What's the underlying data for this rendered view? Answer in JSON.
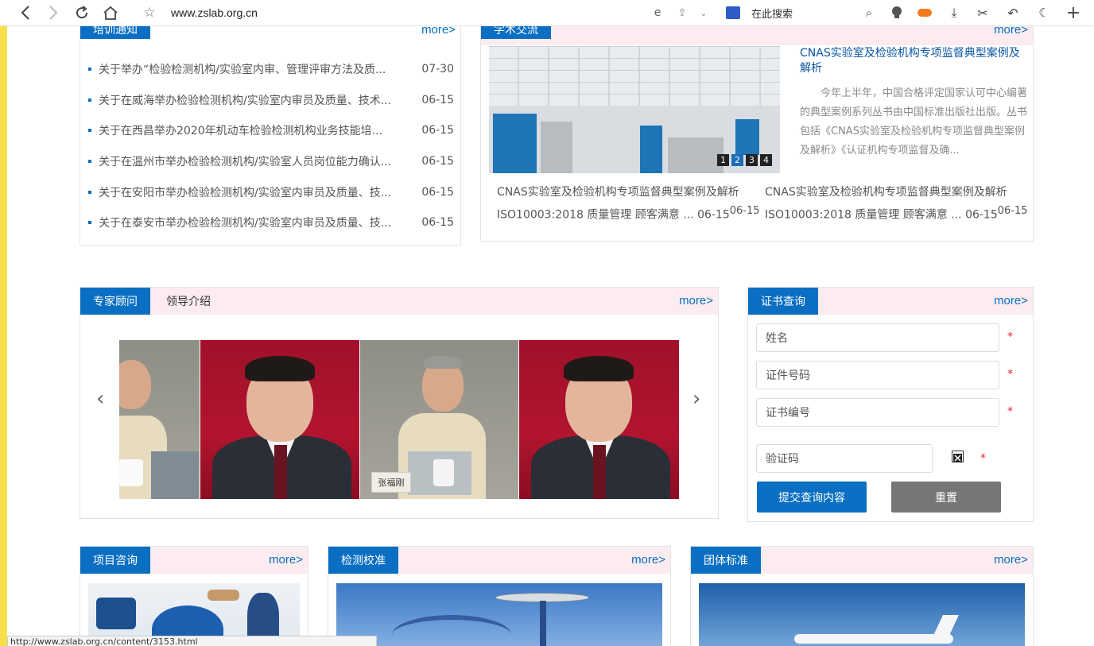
{
  "browser": {
    "url": "www.zslab.org.cn",
    "search_placeholder": "在此搜索",
    "status_url": "http://www.zslab.org.cn/content/3153.html"
  },
  "training": {
    "tab": "培训通知",
    "more": "more>",
    "items": [
      {
        "title": "关于举办“检验检测机构/实验室内审、管理评审方法及质...",
        "date": "07-30"
      },
      {
        "title": "关于在威海举办检验检测机构/实验室内审员及质量、技术...",
        "date": "06-15"
      },
      {
        "title": "关于在西昌举办2020年机动车检验检测机构业务技能培...",
        "date": "06-15"
      },
      {
        "title": "关于在温州市举办检验检测机构/实验室人员岗位能力确认...",
        "date": "06-15"
      },
      {
        "title": "关于在安阳市举办检验检测机构/实验室内审员及质量、技...",
        "date": "06-15"
      },
      {
        "title": "关于在泰安市举办检验检测机构/实验室内审员及质量、技...",
        "date": "06-15"
      }
    ]
  },
  "academic": {
    "tab": "学术交流",
    "more": "more>",
    "slider_dots": [
      "1",
      "2",
      "3",
      "4"
    ],
    "active_dot": "2",
    "feature_title": "CNAS实验室及检验机构专项监督典型案例及解析",
    "feature_desc": "今年上半年，中国合格评定国家认可中心编著的典型案例系列丛书由中国标准出版社出版。丛书包括《CNAS实验室及检验机构专项监督典型案例及解析》《认证机构专项监督及确...",
    "items": [
      {
        "title": "CNAS实验室及检验机构专项监督典型案例及解析",
        "sub": "ISO10003:2018 质量管理 顾客满意 ... 06-15",
        "sup": "06-15"
      },
      {
        "title": "CNAS实验室及检验机构专项监督典型案例及解析",
        "sub": "ISO10003:2018 质量管理 顾客满意 ... 06-15",
        "sup": "06-15"
      }
    ]
  },
  "experts": {
    "tab_active": "专家顾问",
    "tab_other": "领导介绍",
    "more": "more>",
    "nameplate": "张福刚",
    "prev": "‹",
    "next": "›"
  },
  "certificate": {
    "tab": "证书查询",
    "more": "more>",
    "name_placeholder": "姓名",
    "id_placeholder": "证件号码",
    "cert_placeholder": "证书编号",
    "captcha_placeholder": "验证码",
    "required_mark": "*",
    "submit_label": "提交查询内容",
    "reset_label": "重置"
  },
  "bottom": {
    "consult_tab": "项目咨询",
    "testing_tab": "检测校准",
    "group_tab": "团体标准",
    "more": "more>"
  },
  "colors": {
    "accent": "#0a6fc2",
    "header_bg": "#fcecef",
    "reset_btn": "#767676"
  }
}
